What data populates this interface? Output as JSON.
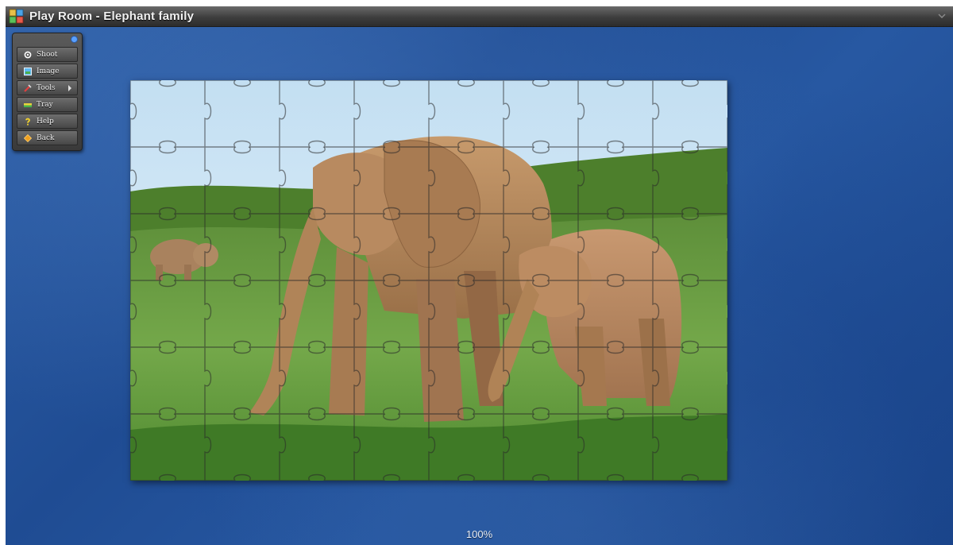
{
  "window": {
    "title": "Play Room - Elephant family"
  },
  "toolbar": {
    "items": [
      {
        "label": "Shoot",
        "icon": "shoot-icon"
      },
      {
        "label": "Image",
        "icon": "image-icon"
      },
      {
        "label": "Tools",
        "icon": "tools-icon",
        "has_submenu": true
      },
      {
        "label": "Tray",
        "icon": "tray-icon"
      },
      {
        "label": "Help",
        "icon": "help-icon"
      },
      {
        "label": "Back",
        "icon": "back-icon"
      }
    ]
  },
  "puzzle": {
    "image_subject": "elephant-family",
    "columns": 8,
    "rows": 6
  },
  "status": {
    "zoom": "100%"
  },
  "colors": {
    "background_blue": "#2455a0",
    "titlebar": "#3e3e3e",
    "toolbar": "#4a4a4a"
  }
}
